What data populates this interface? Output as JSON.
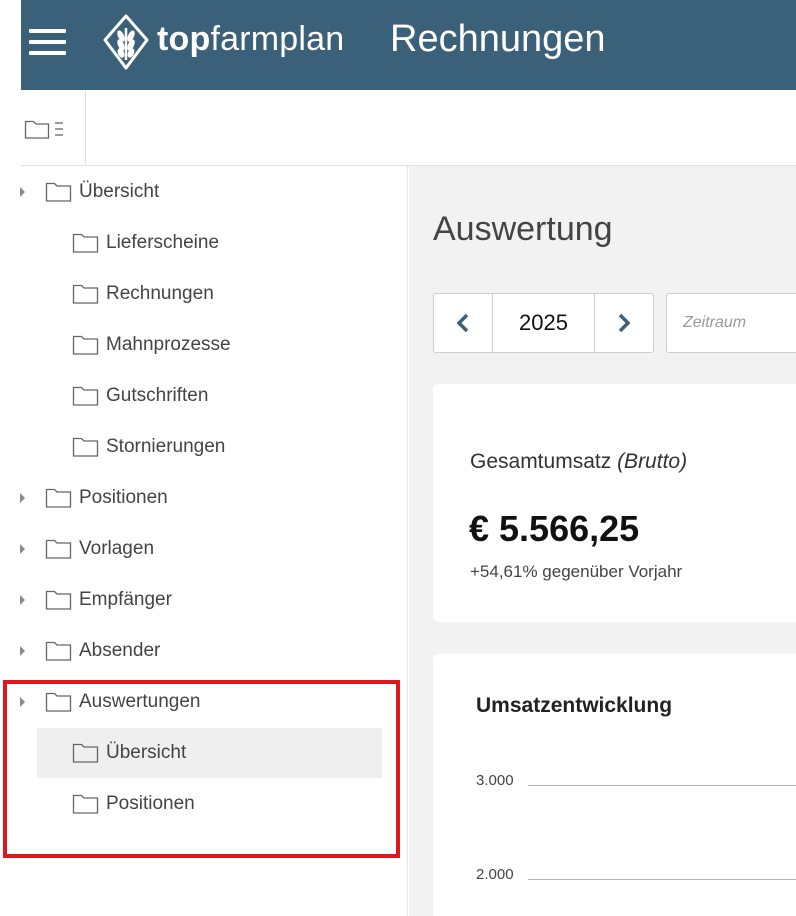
{
  "header": {
    "brand_bold": "top",
    "brand_light": "farmplan",
    "title": "Rechnungen",
    "menu_icon": "hamburger-icon",
    "logo_icon": "wheat-logo-icon",
    "color": "#3b6079"
  },
  "toolbar": {
    "folder_tree_icon": "folder-tree-icon"
  },
  "sidebar": {
    "items": [
      {
        "label": "Übersicht",
        "expandable": true
      },
      {
        "label": "Lieferscheine",
        "expandable": false
      },
      {
        "label": "Rechnungen",
        "expandable": false
      },
      {
        "label": "Mahnprozesse",
        "expandable": false
      },
      {
        "label": "Gutschriften",
        "expandable": false
      },
      {
        "label": "Stornierungen",
        "expandable": false
      },
      {
        "label": "Positionen",
        "expandable": true
      },
      {
        "label": "Vorlagen",
        "expandable": true
      },
      {
        "label": "Empfänger",
        "expandable": true
      },
      {
        "label": "Absender",
        "expandable": true
      },
      {
        "label": "Auswertungen",
        "expandable": true
      },
      {
        "label": "Übersicht",
        "expandable": false,
        "selected": true
      },
      {
        "label": "Positionen",
        "expandable": false
      }
    ],
    "highlight_color": "#e0181b"
  },
  "main": {
    "title": "Auswertung",
    "year": "2025",
    "zeitraum_placeholder": "Zeitraum",
    "revenue_label": "Gesamtumsatz",
    "revenue_label_suffix": "(Brutto)",
    "revenue_amount": "€ 5.566,25",
    "revenue_change": "+54,61% gegenüber Vorjahr",
    "chart_title": "Umsatzentwicklung",
    "chart_ticks": [
      "3.000",
      "2.000"
    ]
  }
}
